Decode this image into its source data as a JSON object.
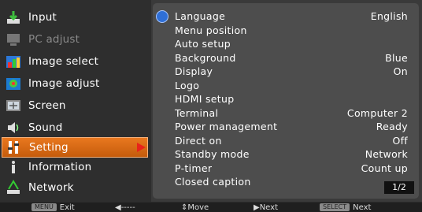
{
  "menu": [
    {
      "label": "Input",
      "icon": "input-arrow-icon",
      "state": "normal"
    },
    {
      "label": "PC adjust",
      "icon": "pc-adjust-icon",
      "state": "dim"
    },
    {
      "label": "Image select",
      "icon": "image-select-icon",
      "state": "normal"
    },
    {
      "label": "Image adjust",
      "icon": "image-adjust-icon",
      "state": "normal"
    },
    {
      "label": "Screen",
      "icon": "screen-icon",
      "state": "normal"
    },
    {
      "label": "Sound",
      "icon": "sound-icon",
      "state": "normal"
    },
    {
      "label": "Setting",
      "icon": "setting-icon",
      "state": "active"
    },
    {
      "label": "Information",
      "icon": "information-icon",
      "state": "normal"
    },
    {
      "label": "Network",
      "icon": "network-icon",
      "state": "normal"
    }
  ],
  "settings": [
    {
      "label": "Language",
      "value": "English"
    },
    {
      "label": "Menu position",
      "value": ""
    },
    {
      "label": "Auto setup",
      "value": ""
    },
    {
      "label": "Background",
      "value": "Blue"
    },
    {
      "label": "Display",
      "value": "On"
    },
    {
      "label": "Logo",
      "value": ""
    },
    {
      "label": "HDMI setup",
      "value": ""
    },
    {
      "label": "Terminal",
      "value": "Computer 2"
    },
    {
      "label": "Power management",
      "value": "Ready"
    },
    {
      "label": "Direct on",
      "value": "Off"
    },
    {
      "label": "Standby mode",
      "value": "Network"
    },
    {
      "label": "P-timer",
      "value": "Count up"
    },
    {
      "label": "Closed caption",
      "value": ""
    }
  ],
  "page_indicator": "1/2",
  "footer": {
    "menu_key": "MENU",
    "exit": "Exit",
    "back": "◀-----",
    "move": "⇕Move",
    "next1": "▶Next",
    "select_key": "SELECT",
    "next2": "Next"
  },
  "colors": {
    "active_bg": "#d9691a",
    "panel_bg": "#4d4d4d",
    "arrow": "#e8231a"
  }
}
